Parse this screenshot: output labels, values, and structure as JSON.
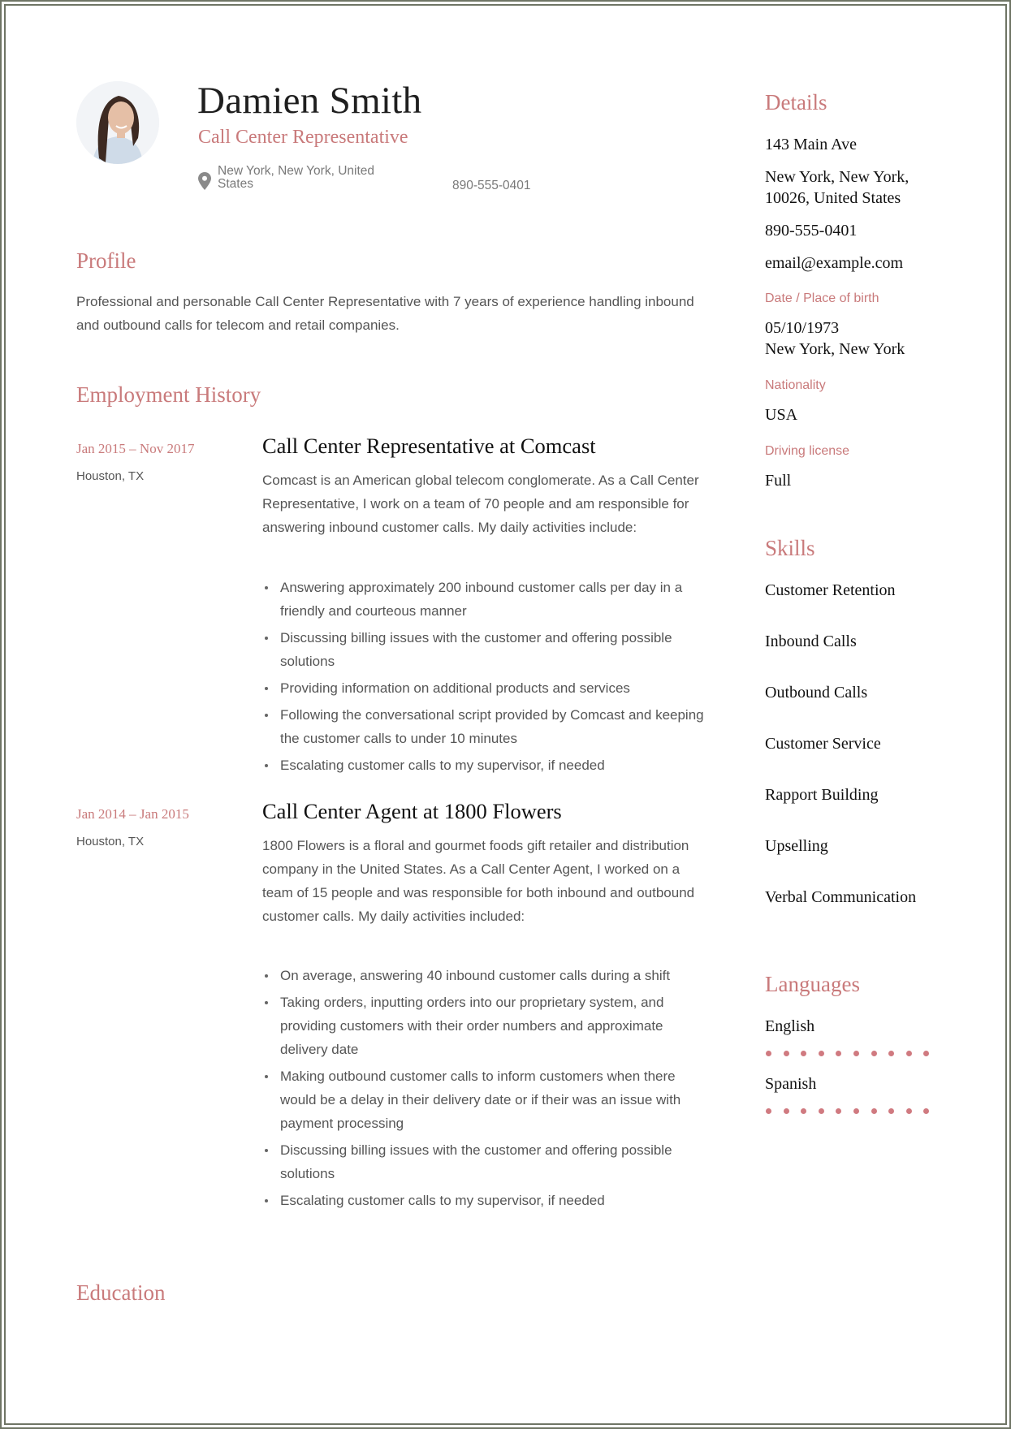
{
  "header": {
    "name": "Damien Smith",
    "job_title": "Call Center Representative",
    "location": "New York, New York, United States",
    "phone": "890-555-0401",
    "avatar": "avatar-photo"
  },
  "profile": {
    "title": "Profile",
    "text": "Professional and personable Call Center Representative with 7 years of experience handling inbound and outbound calls for telecom and retail companies."
  },
  "employment": {
    "title": "Employment History",
    "jobs": [
      {
        "dates": "Jan 2015 – Nov 2017",
        "location": "Houston, TX",
        "title": "Call Center Representative at Comcast",
        "description": "Comcast is an American global telecom conglomerate. As a Call Center Representative, I work on a team of 70 people and am responsible for answering inbound customer calls. My daily activities include:",
        "bullets": [
          "Answering approximately 200 inbound customer calls per day in a friendly and courteous manner",
          "Discussing billing issues with the customer and offering possible solutions",
          "Providing information on additional products and services",
          "Following the conversational script provided by Comcast and keeping the customer calls to under 10 minutes",
          "Escalating customer calls to my supervisor, if needed"
        ]
      },
      {
        "dates": "Jan 2014 – Jan 2015",
        "location": "Houston, TX",
        "title": "Call Center Agent at 1800 Flowers",
        "description": "1800 Flowers is a floral and gourmet foods gift retailer and distribution company in the United States. As a Call Center Agent, I worked on a team of 15 people and was responsible for both inbound and outbound customer calls. My daily activities included:",
        "bullets": [
          "On average, answering 40 inbound customer calls during a shift",
          "Taking orders, inputting orders into our proprietary system, and providing customers with their order numbers and approximate delivery date",
          "Making outbound customer calls to inform customers when there would be a delay in their delivery date or if their was an issue with payment processing",
          "Discussing billing issues with the customer and offering possible solutions",
          "Escalating customer calls to my supervisor, if needed"
        ]
      }
    ]
  },
  "education": {
    "title": "Education"
  },
  "details": {
    "title": "Details",
    "address": "143 Main Ave",
    "city": "New York, New York, 10026, United States",
    "phone": "890-555-0401",
    "email": "email@example.com",
    "birth_label": "Date / Place of birth",
    "birth_date": "05/10/1973",
    "birth_place": "New York, New York",
    "nationality_label": "Nationality",
    "nationality": "USA",
    "license_label": "Driving license",
    "license": "Full"
  },
  "skills": {
    "title": "Skills",
    "items": [
      "Customer Retention",
      "Inbound Calls",
      "Outbound Calls",
      "Customer Service",
      "Rapport Building",
      "Upselling",
      "Verbal Communication"
    ]
  },
  "languages": {
    "title": "Languages",
    "items": [
      {
        "name": "English",
        "level": 10,
        "max": 10
      },
      {
        "name": "Spanish",
        "level": 10,
        "max": 10
      }
    ]
  },
  "colors": {
    "accent": "#c97a7b",
    "frame": "#6f7565"
  }
}
